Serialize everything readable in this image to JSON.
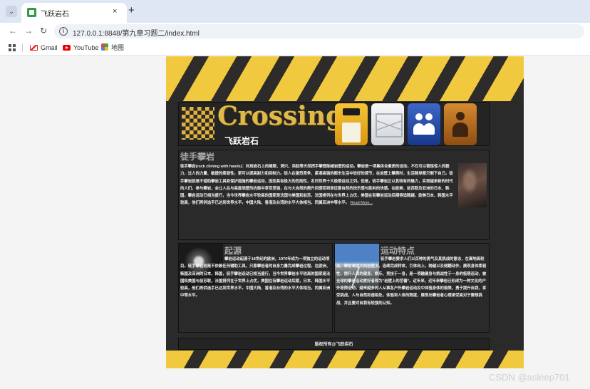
{
  "browser": {
    "tab_title": "飞跃岩石",
    "tab_close": "×",
    "new_tab": "+",
    "url": "127.0.0.1:8848/第九章习题二/index.html",
    "bookmarks": [
      "Gmail",
      "YouTube",
      "地图"
    ]
  },
  "header": {
    "logo_text": "Crossing",
    "site_name": "飞跃岩石",
    "nav_icons": [
      "disk-icon",
      "mail-icon",
      "users-icon",
      "contact-icon"
    ]
  },
  "intro": {
    "title": "徒手攀岩",
    "body": "徒手攀岩(rock climing with hands)：利用岩石上的缝隙、洞穴、突起等天然把手攀登陡峭岩壁的运动。攀岩是一项集体合素质的运动，不仅可以锻炼惊人的毅力，过人的力量、敏捷的柔韧性，更可以提高耐力和抑制力。徒人在激烈竞争、紧凑高强的都市生活中较好的调节，在岩壁上攀爬时，生活随单都只剩下自己。徒手攀岩就是不借助攀岩工具和保护措施的攀岩运动，因而具有极大的危险性，名列世界十大极限运动之列。但是，徒手攀岩正以其特有的魅力，实现越多新的时代的人们，参与攀岩，会让人在与高度顽壁的抗衡中享受坚强，在与大自然的爬升间感受到奋征服自然的快乐感与胜利的快感。在欧美、前苏联及亚洲的日本、韩国，攀岩运动已相当盛行，当今世界攀岩水平较高的国家是法国与美国和前苏，法国排列在与世界上占优，美国在有攀岩运动后期得追随越，欧美日本、韩国水平较高，他们再供选手已达到世界水平。中国大陆、香港及台湾的水平大体相当，同属亚洲中等水平。",
    "read_more": "Read More..."
  },
  "origin": {
    "title": "起源",
    "body": "攀岩运动起源于18世纪的欧洲，1970年成为一项独立的运动项目。徒手攀岩则是不依赖任何辅助工具，只靠攀岩者的自身力量完成攀岩过程。在欧洲、韩国及亚洲的日本、韩国，徒手攀岩运动已相当盛行，当今世界攀岩水平较高的国家是法国和美国与前苏联，法国排列在于世界上占优，美国在有攀岩运动后期，日本、韩国水平较高，他们再供选手已达到世界水平。中国大陆、香港及台湾的水平大体相当，同属亚洲中等水平。"
  },
  "features": {
    "title": "运动特点",
    "body": "徒手攀岩要求人们以百种的勇气及其挑战的意志，在离地面较高、攀附难度大的岩壁上，连续完成转体、引体向上，跨越以及侧翻动作，展现身体柔韧性，提升人员的健身、娱乐、竞技于一身，是一项融健身与挑战性于一身的极限运动，被全球的攀岩运动爱好者称为\"岩壁上的芭蕾\"。近年来，近年来攀岩已形成为一种文化的户外极限运动，越来越多的人从事各户外攀岩运动及中体验身体的极限，勇于提升自我，享受挑战，人与自然和谐相处，体验到人体的限度，展现出攀岩者心理承受高对于要想挑战、并且要对自我有较强的认知。"
  },
  "footer": {
    "text": "版权所有@飞跃岩石"
  },
  "watermark": "CSDN @asleep701"
}
